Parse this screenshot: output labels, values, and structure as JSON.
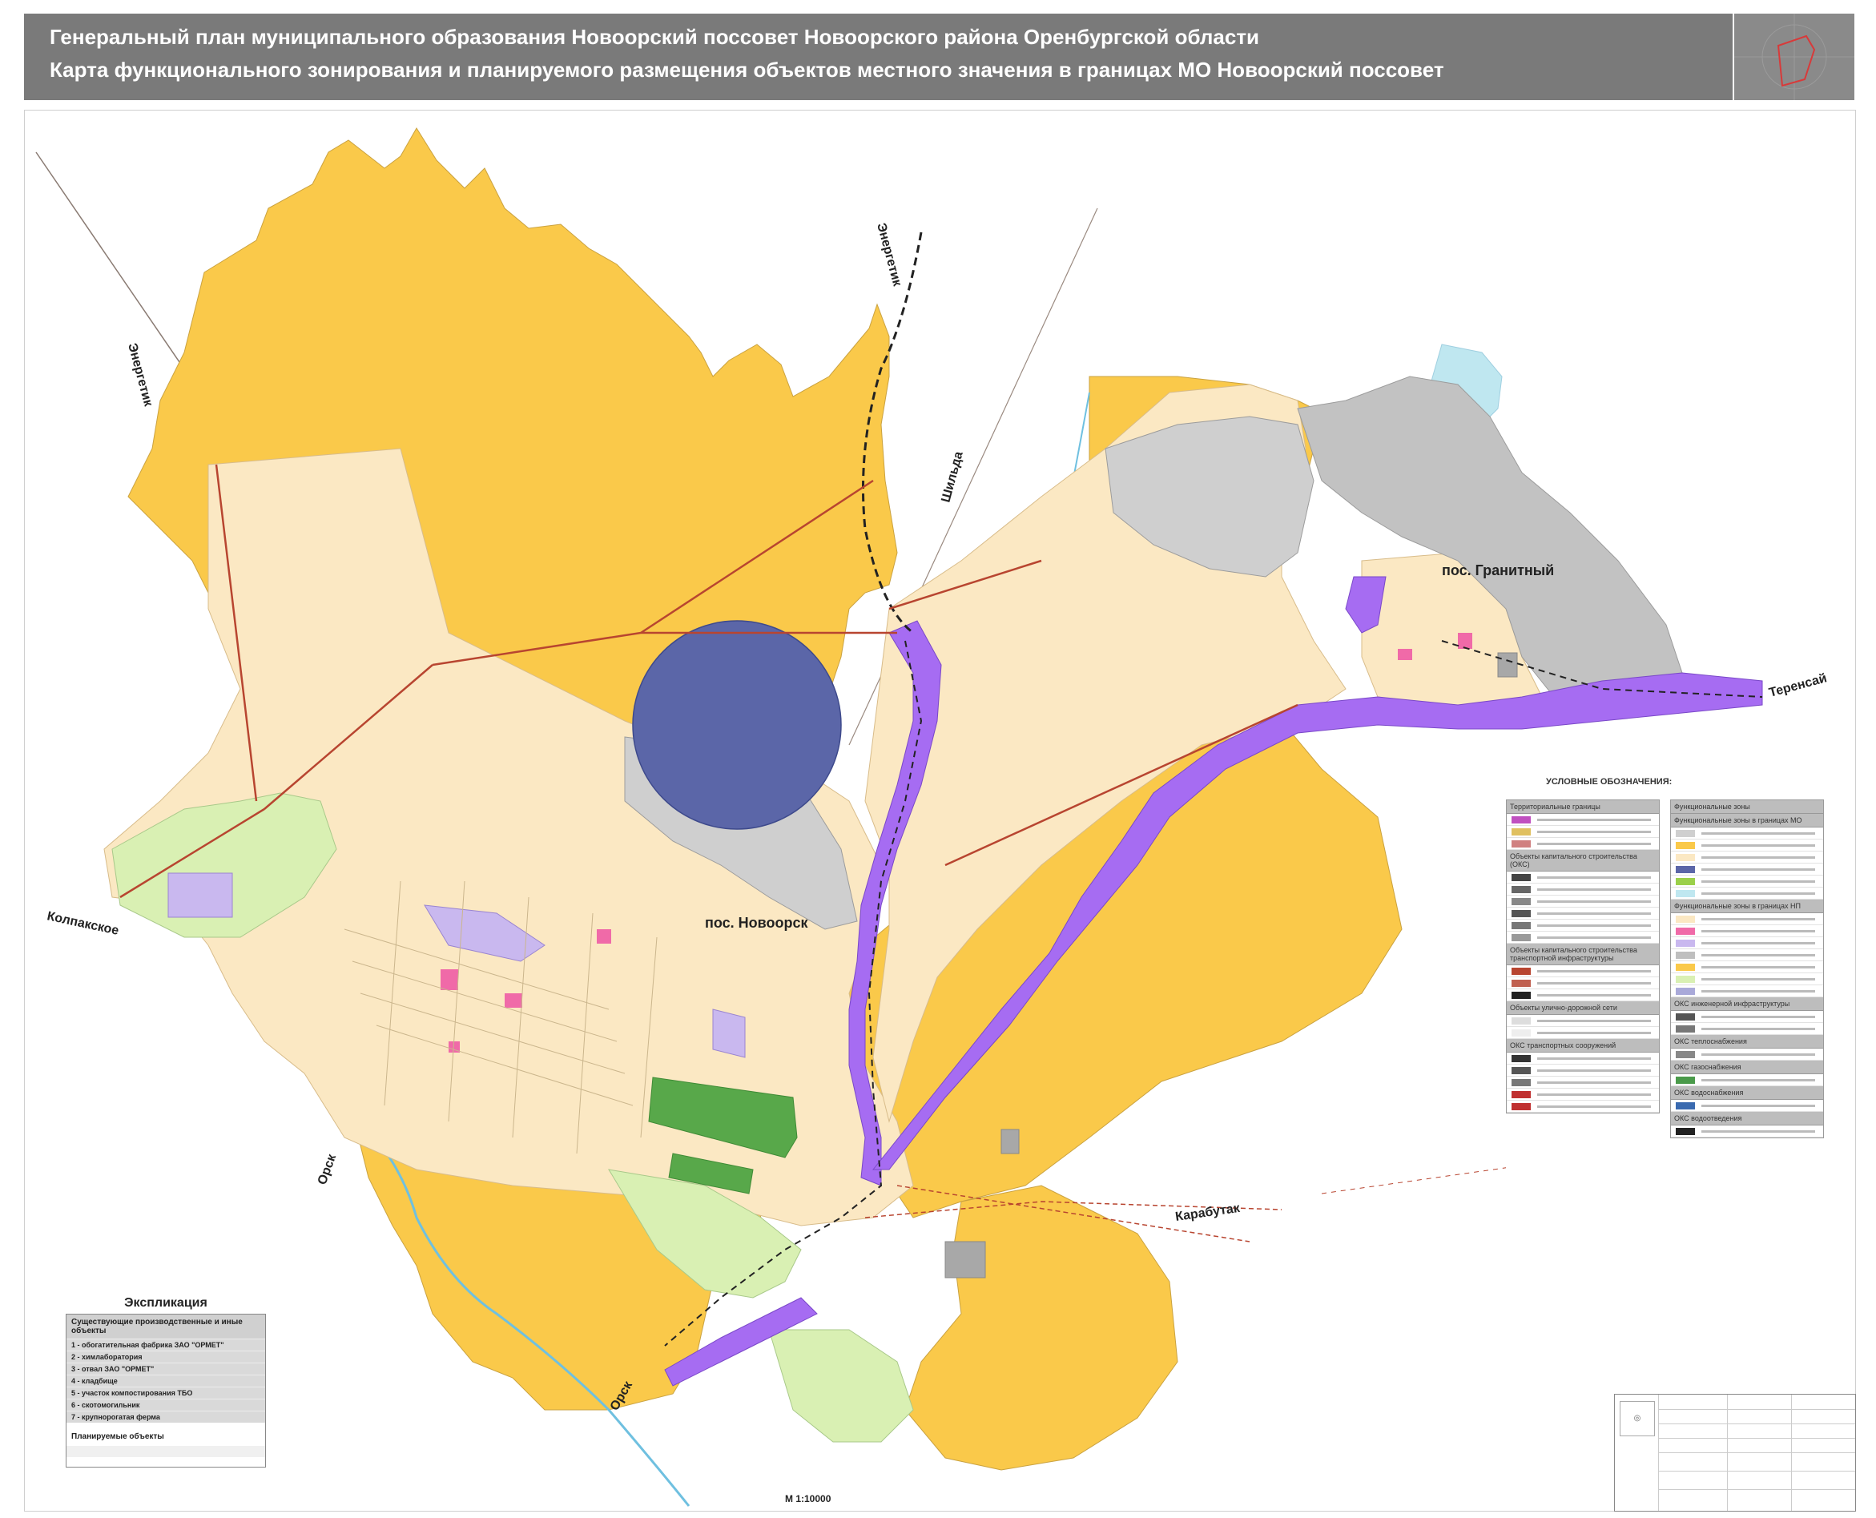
{
  "header": {
    "title_line1": "Генеральный план муниципального образования Новоорский поссовет Новоорского района Оренбургской области",
    "title_line2": "Карта функционального зонирования и планируемого размещения объектов местного значения в границах МО Новоорский поссовет"
  },
  "map": {
    "settlements": [
      "пос. Новоорск",
      "пос. Гранитный"
    ],
    "directions": [
      "Энергетик",
      "Энергетик",
      "Шильда",
      "Теренсай",
      "Колпакское",
      "Орск",
      "Карабутак",
      "Орск"
    ],
    "colors": {
      "agricultural": "#fac94a",
      "residential": "#fbe8c3",
      "industrial": "#bfbfbf",
      "transport": "#a66cf2",
      "special": "#5b66a8",
      "recreation": "#d9f0b3",
      "forest": "#58a84a",
      "water": "#bfe7f0",
      "public_business": "#f06aa8",
      "boundary": "#b84530"
    }
  },
  "legend": {
    "title": "УСЛОВНЫЕ ОБОЗНАЧЕНИЯ:",
    "left_sections": [
      "Территориальные границы",
      "Объекты капитального строительства (ОКС)",
      "Объекты капитального строительства транспортной инфраструктуры",
      "Объекты улично-дорожной сети",
      "ОКС транспортных сооружений"
    ],
    "right_sections": [
      "Функциональные зоны",
      "Функциональные зоны в границах МО",
      "Функциональные зоны в границах НП",
      "ОКС инженерной инфраструктуры",
      "ОКС теплоснабжения",
      "ОКС газоснабжения",
      "ОКС водоснабжения",
      "ОКС водоотведения"
    ]
  },
  "explication": {
    "title": "Экспликация",
    "existing_header": "Существующие производственные и иные объекты",
    "items": [
      "1 - обогатительная фабрика ЗАО \"ОРМЕТ\"",
      "2 - химлаборатория",
      "3 - отвал ЗАО \"ОРМЕТ\"",
      "4 - кладбище",
      "5 - участок компостирования ТБО",
      "6 - скотомогильник",
      "7 - крупнорогатая ферма"
    ],
    "planned_header": "Планируемые объекты"
  },
  "scale": "М 1:10000"
}
